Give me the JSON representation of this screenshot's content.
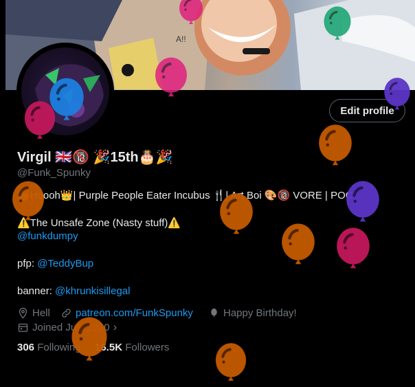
{
  "profile": {
    "name": "Virgil 🇬🇧🔞 🎉15th🎂🎉",
    "handle": "@Funk_Spunky",
    "edit_label": "Edit profile",
    "bio": {
      "line1": "👑Hoooh👑| Purple People Eater Incubus 🍴| Art Boi 🎨🔞 VORE | POC",
      "line2": "⚠️The Unsafe Zone (Nasty stuff)⚠️",
      "line3_link": "@funkdumpy",
      "line4_prefix": "pfp: ",
      "line4_link": "@TeddyBup",
      "line5_prefix": "banner: ",
      "line5_link": "@khrunkisillegal"
    },
    "location": "Hell",
    "website": "patreon.com/FunkSpunky",
    "birthday": "Happy Birthday!",
    "joined": "Joined July 2020",
    "following_count": "306",
    "following_label": "Following",
    "followers_count": "16.5K",
    "followers_label": "Followers"
  },
  "banner_text": "A!!",
  "balloon_colors": {
    "orange": "#c55a00",
    "magenta": "#c2185b",
    "purple": "#5b35c8",
    "green": "#12a36e",
    "blue": "#1d7fe0",
    "pink": "#e0217f"
  }
}
